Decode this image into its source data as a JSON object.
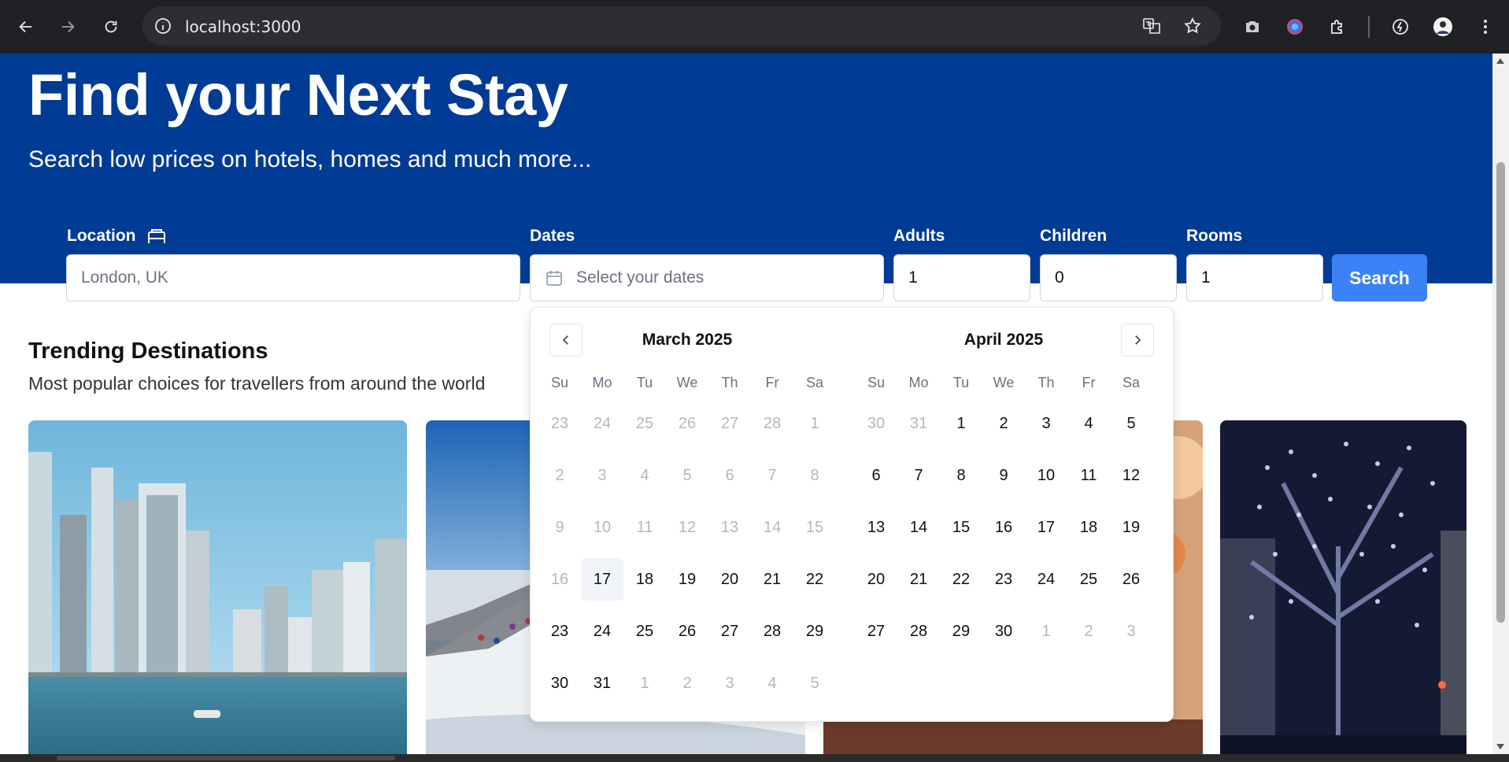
{
  "browser": {
    "url": "localhost:3000",
    "icons": [
      "back-icon",
      "forward-icon",
      "reload-icon",
      "site-info-icon",
      "translate-icon",
      "bookmark-star-icon",
      "screenshot-icon",
      "extension-color-icon",
      "extensions-puzzle-icon",
      "performance-icon",
      "profile-avatar",
      "more-menu-icon"
    ]
  },
  "hero": {
    "title": "Find your Next Stay",
    "subtitle": "Search low prices on hotels, homes and much more..."
  },
  "search": {
    "location_label": "Location",
    "location_placeholder": "London, UK",
    "dates_label": "Dates",
    "dates_placeholder": "Select your dates",
    "adults_label": "Adults",
    "adults_value": "1",
    "children_label": "Children",
    "children_value": "0",
    "rooms_label": "Rooms",
    "rooms_value": "1",
    "search_label": "Search"
  },
  "trending": {
    "title": "Trending Destinations",
    "subtitle": "Most popular choices for travellers from around the world"
  },
  "calendar": {
    "weekdays": [
      "Su",
      "Mo",
      "Tu",
      "We",
      "Th",
      "Fr",
      "Sa"
    ],
    "months": [
      {
        "title": "March 2025",
        "weeks": [
          [
            {
              "d": "23",
              "m": 1
            },
            {
              "d": "24",
              "m": 1
            },
            {
              "d": "25",
              "m": 1
            },
            {
              "d": "26",
              "m": 1
            },
            {
              "d": "27",
              "m": 1
            },
            {
              "d": "28",
              "m": 1
            },
            {
              "d": "1",
              "m": 1
            }
          ],
          [
            {
              "d": "2",
              "m": 1
            },
            {
              "d": "3",
              "m": 1
            },
            {
              "d": "4",
              "m": 1
            },
            {
              "d": "5",
              "m": 1
            },
            {
              "d": "6",
              "m": 1
            },
            {
              "d": "7",
              "m": 1
            },
            {
              "d": "8",
              "m": 1
            }
          ],
          [
            {
              "d": "9",
              "m": 1
            },
            {
              "d": "10",
              "m": 1
            },
            {
              "d": "11",
              "m": 1
            },
            {
              "d": "12",
              "m": 1
            },
            {
              "d": "13",
              "m": 1
            },
            {
              "d": "14",
              "m": 1
            },
            {
              "d": "15",
              "m": 1
            }
          ],
          [
            {
              "d": "16",
              "m": 1
            },
            {
              "d": "17",
              "t": 1
            },
            {
              "d": "18"
            },
            {
              "d": "19"
            },
            {
              "d": "20"
            },
            {
              "d": "21"
            },
            {
              "d": "22"
            }
          ],
          [
            {
              "d": "23"
            },
            {
              "d": "24"
            },
            {
              "d": "25"
            },
            {
              "d": "26"
            },
            {
              "d": "27"
            },
            {
              "d": "28"
            },
            {
              "d": "29"
            }
          ],
          [
            {
              "d": "30"
            },
            {
              "d": "31"
            },
            {
              "d": "1",
              "m": 1
            },
            {
              "d": "2",
              "m": 1
            },
            {
              "d": "3",
              "m": 1
            },
            {
              "d": "4",
              "m": 1
            },
            {
              "d": "5",
              "m": 1
            }
          ]
        ]
      },
      {
        "title": "April 2025",
        "weeks": [
          [
            {
              "d": "30",
              "m": 1
            },
            {
              "d": "31",
              "m": 1
            },
            {
              "d": "1"
            },
            {
              "d": "2"
            },
            {
              "d": "3"
            },
            {
              "d": "4"
            },
            {
              "d": "5"
            }
          ],
          [
            {
              "d": "6"
            },
            {
              "d": "7"
            },
            {
              "d": "8"
            },
            {
              "d": "9"
            },
            {
              "d": "10"
            },
            {
              "d": "11"
            },
            {
              "d": "12"
            }
          ],
          [
            {
              "d": "13"
            },
            {
              "d": "14"
            },
            {
              "d": "15"
            },
            {
              "d": "16"
            },
            {
              "d": "17"
            },
            {
              "d": "18"
            },
            {
              "d": "19"
            }
          ],
          [
            {
              "d": "20"
            },
            {
              "d": "21"
            },
            {
              "d": "22"
            },
            {
              "d": "23"
            },
            {
              "d": "24"
            },
            {
              "d": "25"
            },
            {
              "d": "26"
            }
          ],
          [
            {
              "d": "27"
            },
            {
              "d": "28"
            },
            {
              "d": "29"
            },
            {
              "d": "30"
            },
            {
              "d": "1",
              "m": 1
            },
            {
              "d": "2",
              "m": 1
            },
            {
              "d": "3",
              "m": 1
            }
          ]
        ]
      }
    ]
  },
  "colors": {
    "hero": "#003b95",
    "search_button": "#3b82f6",
    "muted_day": "#b4b8bf"
  }
}
